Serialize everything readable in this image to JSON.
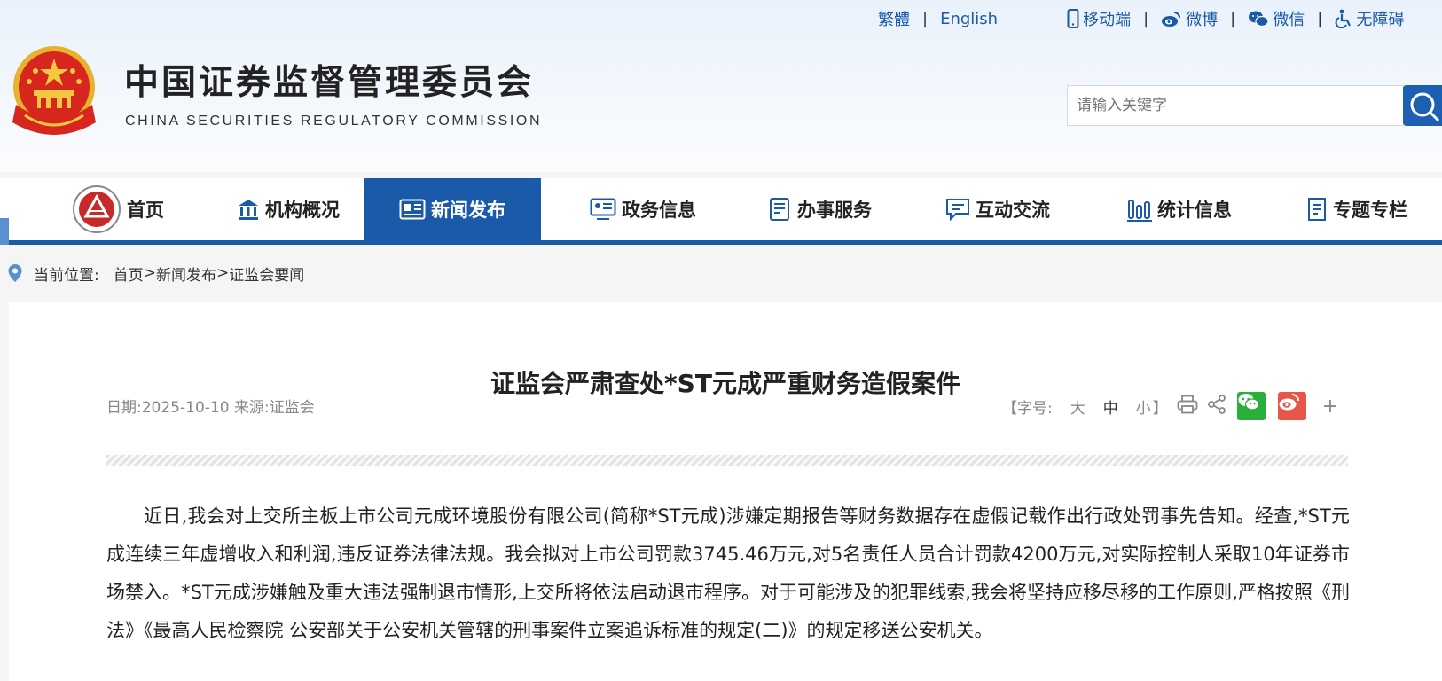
{
  "top_links": {
    "traditional": "繁體",
    "english": "English",
    "mobile": "移动端",
    "weibo": "微博",
    "wechat": "微信",
    "accessibility": "无障碍"
  },
  "site": {
    "name_cn": "中国证券监督管理委员会",
    "name_en": "CHINA SECURITIES REGULATORY COMMISSION"
  },
  "search": {
    "placeholder": "请输入关键字"
  },
  "nav": {
    "items": [
      {
        "label": "首页",
        "icon": "csrc-logo-icon"
      },
      {
        "label": "机构概况",
        "icon": "institution-icon"
      },
      {
        "label": "新闻发布",
        "icon": "news-icon",
        "active": true
      },
      {
        "label": "政务信息",
        "icon": "government-info-icon"
      },
      {
        "label": "办事服务",
        "icon": "service-icon"
      },
      {
        "label": "互动交流",
        "icon": "chat-icon"
      },
      {
        "label": "统计信息",
        "icon": "statistics-icon"
      },
      {
        "label": "专题专栏",
        "icon": "topic-icon"
      }
    ]
  },
  "breadcrumb": {
    "label": "当前位置:",
    "items": [
      "首页",
      "新闻发布",
      "证监会要闻"
    ],
    "separator": ">"
  },
  "article": {
    "title": "证监会严肃查处*ST元成严重财务造假案件",
    "date_label": "日期:",
    "date": "2025-10-10",
    "source_label": "来源:",
    "source": "证监会",
    "font_label": "【字号:",
    "font_large": "大",
    "font_medium": "中",
    "font_small": "小",
    "font_close": "】",
    "more": "+",
    "body": "近日,我会对上交所主板上市公司元成环境股份有限公司(简称*ST元成)涉嫌定期报告等财务数据存在虚假记载作出行政处罚事先告知。经查,*ST元成连续三年虚增收入和利润,违反证券法律法规。我会拟对上市公司罚款3745.46万元,对5名责任人员合计罚款4200万元,对实际控制人采取10年证券市场禁入。*ST元成涉嫌触及重大违法强制退市情形,上交所将依法启动退市程序。对于可能涉及的犯罪线索,我会将坚持应移尽移的工作原则,严格按照《刑法》《最高人民检察院 公安部关于公安机关管辖的刑事案件立案追诉标准的规定(二)》的规定移送公安机关。"
  },
  "colors": {
    "primary": "#1a5aa8",
    "wechat": "#2aae3c",
    "weibo": "#e6574a"
  }
}
